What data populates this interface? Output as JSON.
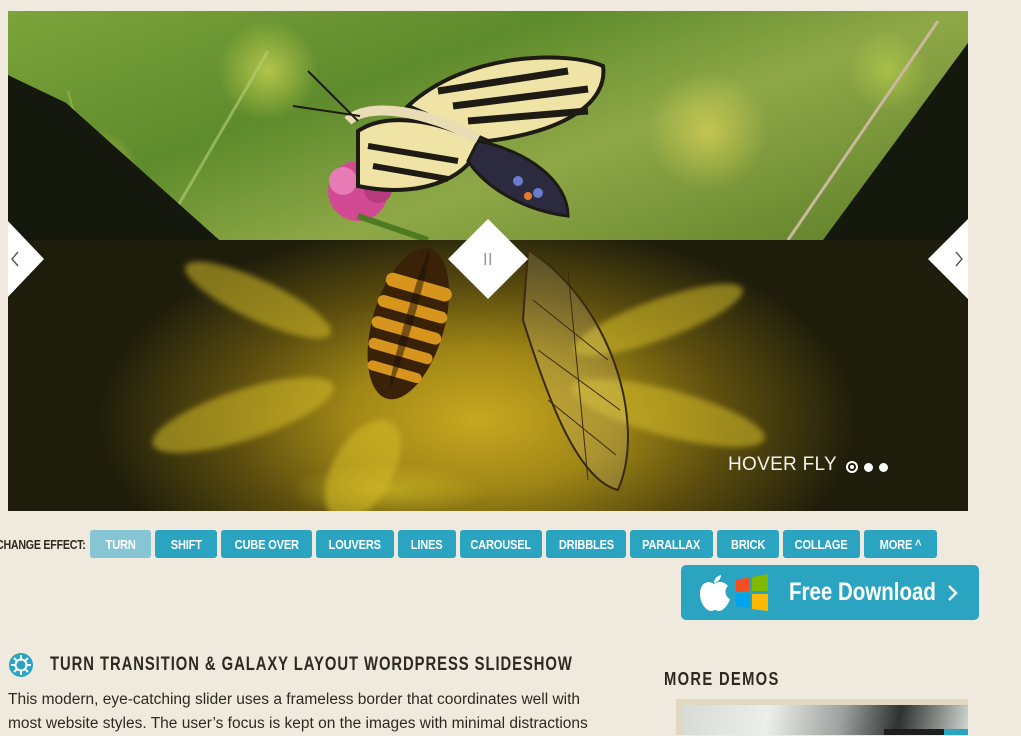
{
  "slider": {
    "caption": "HOVER FLY",
    "dots_total": 3,
    "active_dot": 1,
    "prev_icon": "chevron-left-icon",
    "next_icon": "chevron-right-icon",
    "pause_icon": "pause-icon"
  },
  "effects": {
    "label": "CHANGE EFFECT:",
    "buttons": [
      "TURN",
      "SHIFT",
      "CUBE OVER",
      "LOUVERS",
      "LINES",
      "CAROUSEL",
      "DRIBBLES",
      "PARALLAX",
      "BRICK",
      "COLLAGE",
      "MORE ^"
    ],
    "active": "TURN"
  },
  "download": {
    "label": "Free Download",
    "icons": [
      "apple-icon",
      "windows-icon",
      "chevron-right-icon"
    ]
  },
  "post": {
    "icon": "gear-icon",
    "title": "TURN TRANSITION & GALAXY LAYOUT WORDPRESS SLIDESHOW",
    "text_line1": "This modern, eye-catching slider uses a frameless border that coordinates well with",
    "text_line2": "most website styles. The user’s focus is kept on the images with minimal distractions"
  },
  "sidebar": {
    "heading": "MORE DEMOS"
  },
  "colors": {
    "page_bg": "#efeadd",
    "accent": "#2aa4c0",
    "accent_active": "#86c5d3",
    "text": "#2d2a22"
  }
}
